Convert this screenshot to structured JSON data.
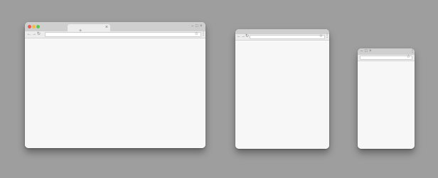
{
  "colors": {
    "background": "#9e9e9e",
    "titlebar": "#cfcfcf",
    "toolbar": "#ececec",
    "content": "#f7f7f7",
    "traffic_red": "#f05a4e",
    "traffic_yellow": "#f5bf3d",
    "traffic_green": "#5fc94f"
  },
  "windows": {
    "desktop": {
      "tab_close": "×",
      "new_tab": "+",
      "controls": [
        "–",
        "□",
        "×"
      ],
      "nav": [
        "←",
        "→",
        "↻"
      ],
      "star": "☆",
      "menu": "⋮"
    },
    "tablet": {
      "nav": [
        "←",
        "→",
        "↻"
      ],
      "star": "☆",
      "menu": "⋮"
    },
    "phone": {
      "controls": [
        "–",
        "□",
        "×"
      ],
      "star": "☆",
      "menu": "⋮"
    }
  },
  "icons": [
    "close-dot",
    "minimize-dot",
    "zoom-dot",
    "back-icon",
    "forward-icon",
    "reload-icon",
    "star-icon",
    "menu-icon",
    "plus-icon",
    "close-icon"
  ]
}
